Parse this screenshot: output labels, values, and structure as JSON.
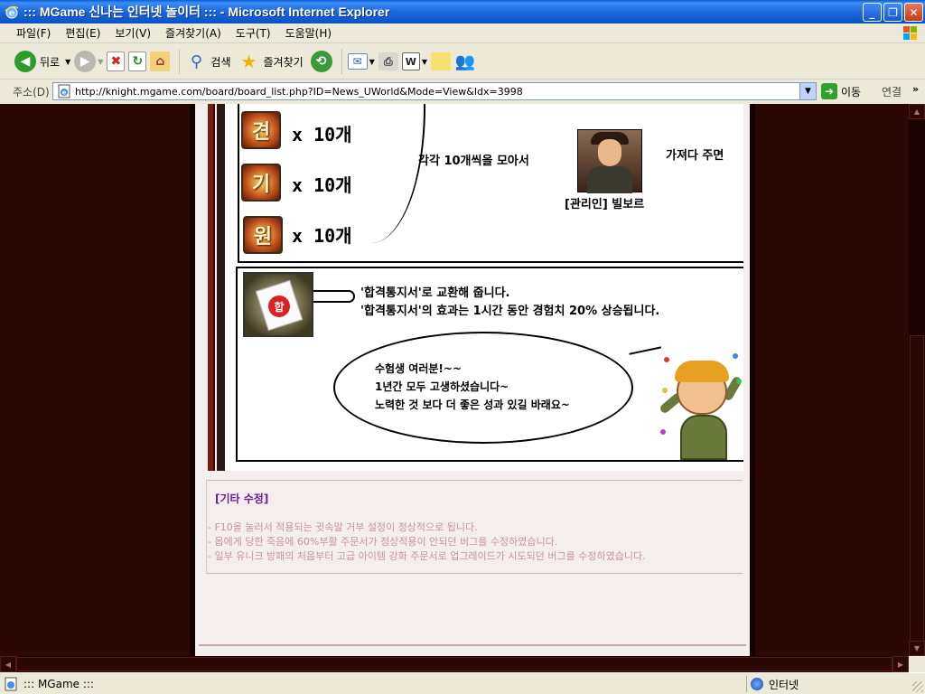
{
  "window": {
    "title": "::: MGame 신나는 인터넷 놀이터 ::: - Microsoft Internet Explorer",
    "controls": {
      "minimize": "_",
      "maximize": "❐",
      "close": "✕"
    }
  },
  "menu": {
    "items": [
      "파일(F)",
      "편집(E)",
      "보기(V)",
      "즐겨찾기(A)",
      "도구(T)",
      "도움말(H)"
    ]
  },
  "toolbar": {
    "back_label": "뒤로",
    "search_label": "검색",
    "favorites_label": "즐겨찾기",
    "icons": [
      "back-icon",
      "forward-icon",
      "stop-icon",
      "refresh-icon",
      "home-icon",
      "search-icon",
      "favorites-icon",
      "history-icon",
      "mail-icon",
      "print-icon",
      "edit-icon",
      "discuss-icon",
      "messenger-icon"
    ]
  },
  "address": {
    "label": "주소(D)",
    "url": "http://knight.mgame.com/board/board_list.php?ID=News_UWorld&Mode=View&Idx=3998",
    "go_label": "이동",
    "links_label": "연결",
    "links_chevron": "»"
  },
  "event": {
    "gems": [
      {
        "glyph": "견",
        "count": "x 10개"
      },
      {
        "glyph": "기",
        "count": "x 10개"
      },
      {
        "glyph": "원",
        "count": "x 10개"
      }
    ],
    "collect_text": "각각 10개씩을 모아서",
    "bring_text": "가져다 주면",
    "npc_name": "[관리인] 빌보르",
    "exchange_line1": "'합격통지서'로 교환해 줍니다.",
    "exchange_line2": "'합격통지서'의 효과는 1시간 동안 경험치 20% 상승됩니다.",
    "seal_glyph": "합",
    "bubble_lines": [
      "수험생 여러분!~~",
      "1년간 모두 고생하셨습니다~",
      "노력한 것 보다 더 좋은 성과 있길 바래요~"
    ]
  },
  "notes": {
    "title": "[기타 수정]",
    "lines": [
      "- F10을 눌러서 적용되는 귓속말 거부 설정이 정상적으로 됩니다.",
      "- 몹에게 당한 죽음에 60%부활 주문서가 정상적용이 안되던 버그를 수정하였습니다.",
      "- 일부 유니크 방패의 처음부터 고급 아이템 강화 주문서로 업그레이드가 시도되던 버그를 수정하였습니다."
    ]
  },
  "status": {
    "text": "::: MGame :::",
    "zone": "인터넷"
  },
  "colors": {
    "title_bar": "#0852c4",
    "page_dark": "#2a0806",
    "content_bg": "#f5eeee",
    "notes_title": "#6a1e9a",
    "notes_text": "#c49696"
  }
}
